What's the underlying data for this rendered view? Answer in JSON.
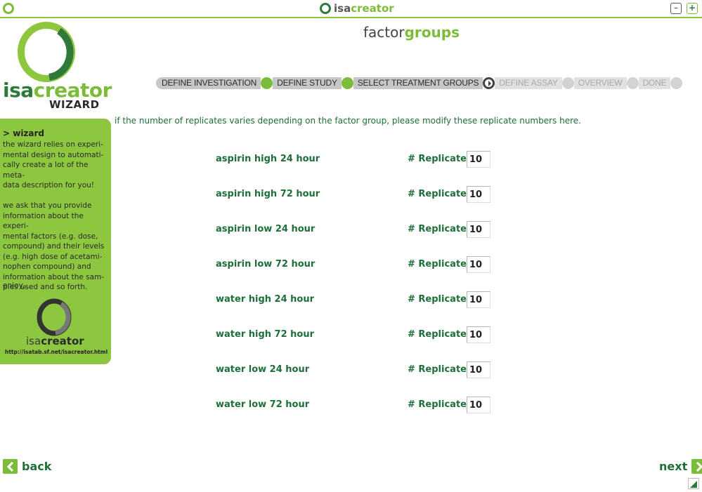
{
  "titlebar": {
    "title_part1": "isa",
    "title_part2": "creator",
    "minimize_label": "–",
    "maximize_label": "+"
  },
  "logo": {
    "text_part1": "isa",
    "text_part2": "creator",
    "subtitle": "WIZARD"
  },
  "page_title": {
    "part1": "factor",
    "part2": "groups"
  },
  "steps": [
    {
      "label": "DEFINE INVESTIGATION",
      "status": "done"
    },
    {
      "label": "DEFINE STUDY",
      "status": "done"
    },
    {
      "label": "SELECT TREATMENT GROUPS",
      "status": "current"
    },
    {
      "label": "DEFINE ASSAY",
      "status": "todo"
    },
    {
      "label": "OVERVIEW",
      "status": "todo"
    },
    {
      "label": "DONE",
      "status": "todo"
    }
  ],
  "sidebar": {
    "heading": "> wizard",
    "text": "the wizard relies on experi-\nmental design to automati-\ncally create a lot of the meta-\ndata description for you!\n\nwe ask that you provide\ninformation about the experi-\nmental factors (e.g. dose,\ncompound) and their levels\n(e.g. high dose of acetami-\nnophen compound) and\ninformation about the sam-\nples used and so forth.",
    "enjoy": "enjoy....",
    "logo_part1": "isa",
    "logo_part2": "creator",
    "url": "http://isatab.sf.net/isacreator.html"
  },
  "instruction": "if the number of replicates varies depending on the factor group, please modify these replicate numbers here.",
  "replicates_label": "# Replicates",
  "groups": [
    {
      "name": "aspirin high 24 hour",
      "replicates": "10"
    },
    {
      "name": "aspirin high 72 hour",
      "replicates": "10"
    },
    {
      "name": "aspirin low 24 hour",
      "replicates": "10"
    },
    {
      "name": "aspirin low 72 hour",
      "replicates": "10"
    },
    {
      "name": "water high 24 hour",
      "replicates": "10"
    },
    {
      "name": "water high 72 hour",
      "replicates": "10"
    },
    {
      "name": "water low 24 hour",
      "replicates": "10"
    },
    {
      "name": "water low 72 hour",
      "replicates": "10"
    }
  ],
  "nav": {
    "back_label": "back",
    "next_label": "next"
  },
  "colors": {
    "accent_green": "#7bbd3a",
    "dark_green": "#1e6e3a",
    "sidebar_green": "#8dc63f",
    "step_gray": "#c7c7c7"
  }
}
